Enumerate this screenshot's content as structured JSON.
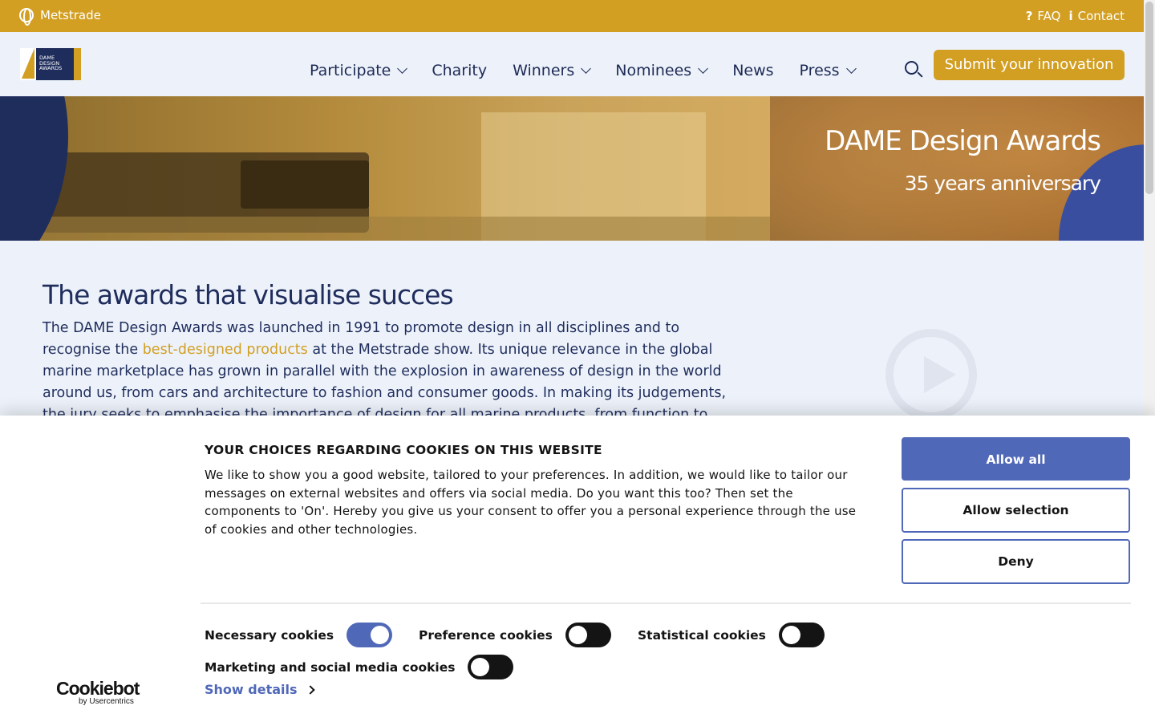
{
  "topbar": {
    "brand": "Metstrade",
    "faq": "FAQ",
    "contact": "Contact"
  },
  "header": {
    "logo_text_1": "DAME",
    "logo_text_2": "DESIGN",
    "logo_text_3": "AWARDS",
    "nav": {
      "participate": "Participate",
      "charity": "Charity",
      "winners": "Winners",
      "nominees": "Nominees",
      "news": "News",
      "press": "Press"
    },
    "cta": "Submit your innovation"
  },
  "hero": {
    "title": "DAME Design Awards",
    "subtitle": "35 years anniversary"
  },
  "content": {
    "heading": "The awards that visualise succes",
    "p_before": "The DAME Design Awards was launched in 1991 to promote design in all disciplines and to recognise the ",
    "p_link": "best-designed products",
    "p_after": " at the Metstrade show. Its unique relevance in the global marine marketplace has grown in parallel with the explosion in awareness of design in the world around us, from cars and architecture to fashion and consumer goods. In making its judgements, the jury seeks to emphasise the importance of design for all marine products, from function to aesthetics and from packaging to the"
  },
  "cookie": {
    "title": "YOUR CHOICES REGARDING COOKIES ON THIS WEBSITE",
    "description": "We like to show you a good website, tailored to your preferences. In addition, we would like to tailor our messages on external websites and offers via social media. Do you want this too? Then set the components to 'On'. Hereby you give us your consent to offer you a personal experience through the use of cookies and other technologies.",
    "allow_all": "Allow all",
    "allow_selection": "Allow selection",
    "deny": "Deny",
    "necessary": "Necessary cookies",
    "preference": "Preference cookies",
    "statistical": "Statistical cookies",
    "marketing": "Marketing and social media cookies",
    "show_details": "Show details",
    "cookiebot": "Cookiebot",
    "cookiebot_by": "by Usercentrics"
  },
  "icons": {
    "globe": "globe-icon",
    "faq": "question-icon",
    "contact": "info-icon",
    "search": "search-icon",
    "play": "play-icon"
  },
  "colors": {
    "gold": "#d29f22",
    "navy": "#1f2d5c",
    "cookie_blue": "#5068b8"
  }
}
